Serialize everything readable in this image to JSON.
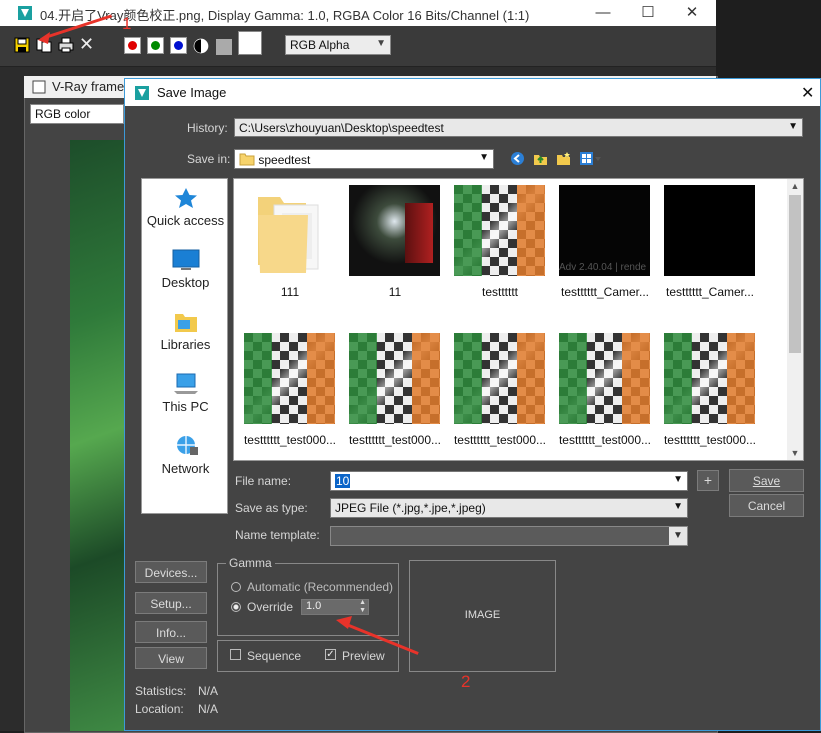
{
  "frame_buffer": {
    "title": "04.开启了Vray颜色校正.png, Display Gamma: 1.0, RGBA Color 16 Bits/Channel (1:1)",
    "channel_select": "RGB Alpha",
    "minimize_glyph": "—",
    "maximize_glyph": "☐",
    "close_glyph": "✕",
    "clear_glyph": "✕"
  },
  "vray_frame": {
    "title": "V-Ray frame",
    "channel_select": "RGB color"
  },
  "dialog": {
    "title": "Save Image",
    "close_glyph": "✕",
    "history_label": "History:",
    "history_value": "C:\\Users\\zhouyuan\\Desktop\\speedtest",
    "savein_label": "Save in:",
    "savein_value": "speedtest",
    "places": [
      {
        "label": "Quick access",
        "icon": "star-icon"
      },
      {
        "label": "Desktop",
        "icon": "desktop-icon"
      },
      {
        "label": "Libraries",
        "icon": "libraries-icon"
      },
      {
        "label": "This PC",
        "icon": "computer-icon"
      },
      {
        "label": "Network",
        "icon": "network-icon"
      }
    ],
    "files": [
      {
        "label": "111",
        "kind": "folder"
      },
      {
        "label": "11",
        "kind": "dark"
      },
      {
        "label": "testttttt",
        "kind": "checker"
      },
      {
        "label": "testttttt_Camer...",
        "kind": "black-text",
        "overlay": "Adv 2.40.04 | rende"
      },
      {
        "label": "testttttt_Camer...",
        "kind": "black"
      },
      {
        "label": "testttttt_test000...",
        "kind": "checker"
      },
      {
        "label": "testttttt_test000...",
        "kind": "checker"
      },
      {
        "label": "testttttt_test000...",
        "kind": "checker"
      },
      {
        "label": "testttttt_test000...",
        "kind": "checker"
      },
      {
        "label": "testttttt_test000...",
        "kind": "checker"
      }
    ],
    "filename_label": "File name:",
    "filename_value": "10",
    "saveas_label": "Save as type:",
    "saveas_value": "JPEG File (*.jpg,*.jpe,*.jpeg)",
    "template_label": "Name template:",
    "plus_label": "+",
    "save_button": "Save",
    "cancel_button": "Cancel",
    "devices_button": "Devices...",
    "setup_button": "Setup...",
    "info_button": "Info...",
    "view_button": "View",
    "gamma_group": "Gamma",
    "gamma_automatic": "Automatic (Recommended)",
    "gamma_override": "Override",
    "gamma_override_value": "1.0",
    "sequence_label": "Sequence",
    "preview_label": "Preview",
    "preview_checked": true,
    "preview_box": "IMAGE",
    "statistics_label": "Statistics:",
    "statistics_value": "N/A",
    "location_label": "Location:",
    "location_value": "N/A"
  },
  "annotations": {
    "marker_1": "1",
    "marker_2": "2",
    "color": "#e8332a"
  }
}
